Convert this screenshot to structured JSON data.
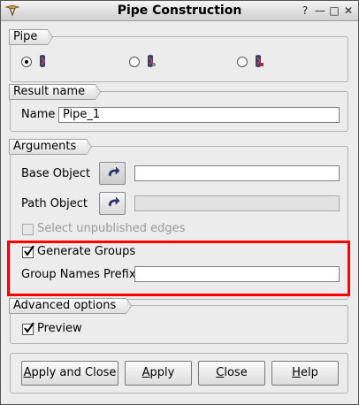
{
  "window": {
    "title": "Pipe Construction"
  },
  "titlebar_buttons": {
    "help": "?",
    "minimize": "—",
    "maximize": "□",
    "close": "✕"
  },
  "pipe_group": {
    "title": "Pipe",
    "selected_option": 1
  },
  "result_group": {
    "title": "Result name",
    "name_label": "Name",
    "name_value": "Pipe_1"
  },
  "arguments_group": {
    "title": "Arguments",
    "base_object_label": "Base Object",
    "base_object_value": "",
    "path_object_label": "Path Object",
    "path_object_value": "",
    "select_unpublished_label": "Select unpublished edges",
    "select_unpublished_checked": false,
    "generate_groups_label": "Generate Groups",
    "generate_groups_checked": true,
    "group_names_prefix_label": "Group Names Prefix",
    "group_names_prefix_value": ""
  },
  "advanced_group": {
    "title": "Advanced options",
    "preview_label": "Preview",
    "preview_checked": true
  },
  "buttons": {
    "apply_and_close": {
      "pre": "",
      "mnemonic": "A",
      "post": "pply and Close"
    },
    "apply": {
      "pre": "",
      "mnemonic": "A",
      "post": "pply"
    },
    "close": {
      "pre": "",
      "mnemonic": "C",
      "post": "lose"
    },
    "help": {
      "pre": "",
      "mnemonic": "H",
      "post": "elp"
    }
  },
  "colors": {
    "highlight": "#ff0000",
    "background": "#ececec"
  }
}
